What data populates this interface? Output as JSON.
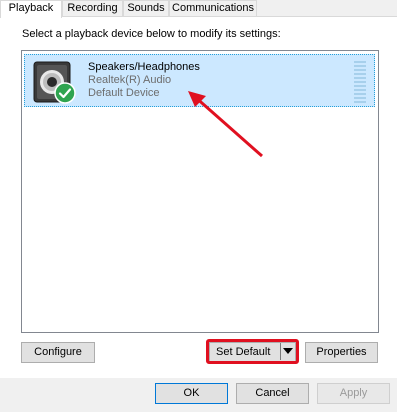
{
  "tabs": [
    {
      "label": "Playback",
      "active": true
    },
    {
      "label": "Recording",
      "active": false
    },
    {
      "label": "Sounds",
      "active": false
    },
    {
      "label": "Communications",
      "active": false
    }
  ],
  "instruction": "Select a playback device below to modify its settings:",
  "device": {
    "name": "Speakers/Headphones",
    "driver": "Realtek(R) Audio",
    "status": "Default Device",
    "icon": "speaker-icon",
    "badge_icon": "green-check-icon"
  },
  "buttons": {
    "configure": "Configure",
    "set_default": "Set Default",
    "properties": "Properties",
    "ok": "OK",
    "cancel": "Cancel",
    "apply": "Apply"
  },
  "colors": {
    "selection": "#cce8ff",
    "highlight_box": "#e01020",
    "arrow": "#e01020",
    "check": "#2fa44f"
  }
}
